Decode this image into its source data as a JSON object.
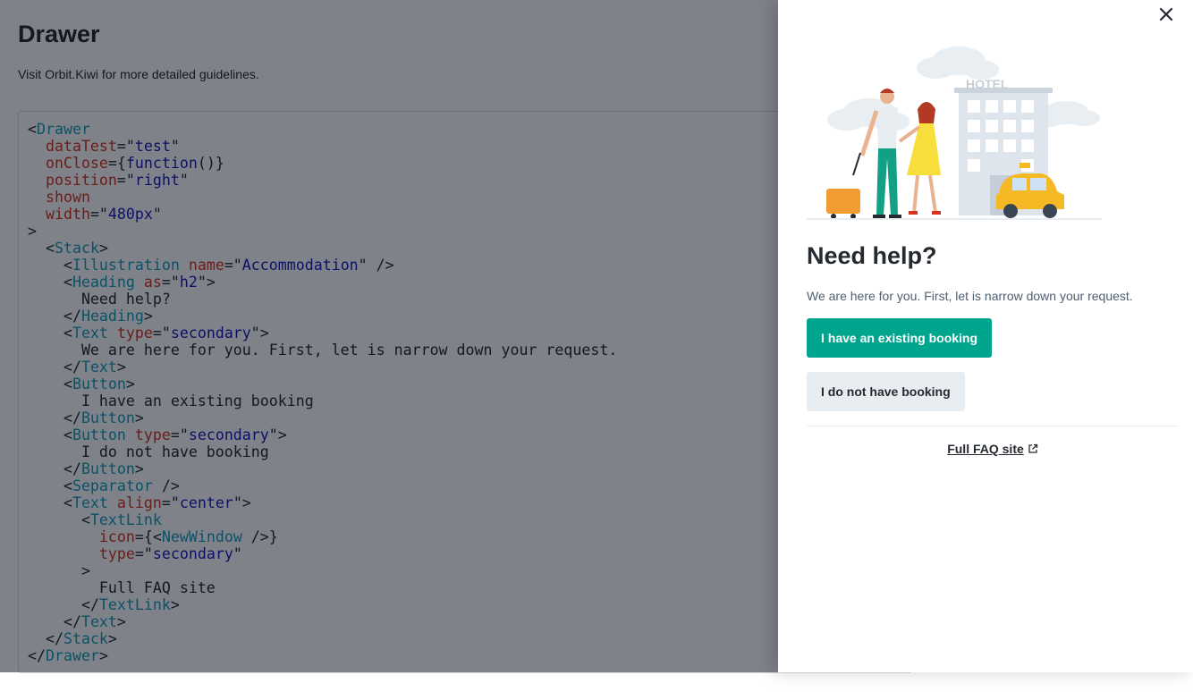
{
  "page": {
    "title": "Drawer",
    "subtitle": "Visit Orbit.Kiwi for more detailed guidelines."
  },
  "code": [
    [
      [
        "pun",
        "<"
      ],
      [
        "tag",
        "Drawer"
      ]
    ],
    [
      [
        "pun",
        "  "
      ],
      [
        "attr",
        "dataTest"
      ],
      [
        "pun",
        "=\""
      ],
      [
        "str",
        "test"
      ],
      [
        "pun",
        "\""
      ]
    ],
    [
      [
        "pun",
        "  "
      ],
      [
        "attr",
        "onClose"
      ],
      [
        "pun",
        "={"
      ],
      [
        "kw",
        "function"
      ],
      [
        "pun",
        "()}"
      ]
    ],
    [
      [
        "pun",
        "  "
      ],
      [
        "attr",
        "position"
      ],
      [
        "pun",
        "=\""
      ],
      [
        "str",
        "right"
      ],
      [
        "pun",
        "\""
      ]
    ],
    [
      [
        "pun",
        "  "
      ],
      [
        "attr",
        "shown"
      ]
    ],
    [
      [
        "pun",
        "  "
      ],
      [
        "attr",
        "width"
      ],
      [
        "pun",
        "=\""
      ],
      [
        "str",
        "480px"
      ],
      [
        "pun",
        "\""
      ]
    ],
    [
      [
        "pun",
        ">"
      ]
    ],
    [
      [
        "pun",
        "  <"
      ],
      [
        "tag",
        "Stack"
      ],
      [
        "pun",
        ">"
      ]
    ],
    [
      [
        "pun",
        "    <"
      ],
      [
        "tag",
        "Illustration"
      ],
      [
        "pun",
        " "
      ],
      [
        "attr",
        "name"
      ],
      [
        "pun",
        "=\""
      ],
      [
        "str",
        "Accommodation"
      ],
      [
        "pun",
        "\" />"
      ]
    ],
    [
      [
        "pun",
        "    <"
      ],
      [
        "tag",
        "Heading"
      ],
      [
        "pun",
        " "
      ],
      [
        "attr",
        "as"
      ],
      [
        "pun",
        "=\""
      ],
      [
        "str",
        "h2"
      ],
      [
        "pun",
        "\">"
      ]
    ],
    [
      [
        "pun",
        "      Need help?"
      ]
    ],
    [
      [
        "pun",
        "    </"
      ],
      [
        "tag",
        "Heading"
      ],
      [
        "pun",
        ">"
      ]
    ],
    [
      [
        "pun",
        "    <"
      ],
      [
        "tag",
        "Text"
      ],
      [
        "pun",
        " "
      ],
      [
        "attr",
        "type"
      ],
      [
        "pun",
        "=\""
      ],
      [
        "str",
        "secondary"
      ],
      [
        "pun",
        "\">"
      ]
    ],
    [
      [
        "pun",
        "      We are here for you. First, let is narrow down your request."
      ]
    ],
    [
      [
        "pun",
        "    </"
      ],
      [
        "tag",
        "Text"
      ],
      [
        "pun",
        ">"
      ]
    ],
    [
      [
        "pun",
        "    <"
      ],
      [
        "tag",
        "Button"
      ],
      [
        "pun",
        ">"
      ]
    ],
    [
      [
        "pun",
        "      I have an existing booking"
      ]
    ],
    [
      [
        "pun",
        "    </"
      ],
      [
        "tag",
        "Button"
      ],
      [
        "pun",
        ">"
      ]
    ],
    [
      [
        "pun",
        "    <"
      ],
      [
        "tag",
        "Button"
      ],
      [
        "pun",
        " "
      ],
      [
        "attr",
        "type"
      ],
      [
        "pun",
        "=\""
      ],
      [
        "str",
        "secondary"
      ],
      [
        "pun",
        "\">"
      ]
    ],
    [
      [
        "pun",
        "      I do not have booking"
      ]
    ],
    [
      [
        "pun",
        "    </"
      ],
      [
        "tag",
        "Button"
      ],
      [
        "pun",
        ">"
      ]
    ],
    [
      [
        "pun",
        "    <"
      ],
      [
        "tag",
        "Separator"
      ],
      [
        "pun",
        " />"
      ]
    ],
    [
      [
        "pun",
        "    <"
      ],
      [
        "tag",
        "Text"
      ],
      [
        "pun",
        " "
      ],
      [
        "attr",
        "align"
      ],
      [
        "pun",
        "=\""
      ],
      [
        "str",
        "center"
      ],
      [
        "pun",
        "\">"
      ]
    ],
    [
      [
        "pun",
        "      <"
      ],
      [
        "tag",
        "TextLink"
      ]
    ],
    [
      [
        "pun",
        "        "
      ],
      [
        "attr",
        "icon"
      ],
      [
        "pun",
        "={<"
      ],
      [
        "tag",
        "NewWindow"
      ],
      [
        "pun",
        " />}"
      ]
    ],
    [
      [
        "pun",
        "        "
      ],
      [
        "attr",
        "type"
      ],
      [
        "pun",
        "=\""
      ],
      [
        "str",
        "secondary"
      ],
      [
        "pun",
        "\""
      ]
    ],
    [
      [
        "pun",
        "      >"
      ]
    ],
    [
      [
        "pun",
        "        Full FAQ site"
      ]
    ],
    [
      [
        "pun",
        "      </"
      ],
      [
        "tag",
        "TextLink"
      ],
      [
        "pun",
        ">"
      ]
    ],
    [
      [
        "pun",
        "    </"
      ],
      [
        "tag",
        "Text"
      ],
      [
        "pun",
        ">"
      ]
    ],
    [
      [
        "pun",
        "  </"
      ],
      [
        "tag",
        "Stack"
      ],
      [
        "pun",
        ">"
      ]
    ],
    [
      [
        "pun",
        "</"
      ],
      [
        "tag",
        "Drawer"
      ],
      [
        "pun",
        ">"
      ]
    ]
  ],
  "drawer": {
    "close_icon": "close-icon",
    "illustration": "Accommodation",
    "illustration_sign": "HOTEL",
    "heading": "Need help?",
    "text": "We are here for you. First, let is narrow down your request.",
    "primary_button": "I have an existing booking",
    "secondary_button": "I do not have booking",
    "faq_link": "Full FAQ site",
    "faq_icon": "new-window-icon"
  },
  "colors": {
    "primary": "#00a58e",
    "secondary_bg": "#e8edf1",
    "text": "#252a31",
    "text_secondary": "#4f5e71",
    "overlay": "rgba(0,8,20,0.5)",
    "code_tag": "#1a9bb8",
    "code_attr": "#d4341e",
    "code_string": "#1818b6"
  }
}
